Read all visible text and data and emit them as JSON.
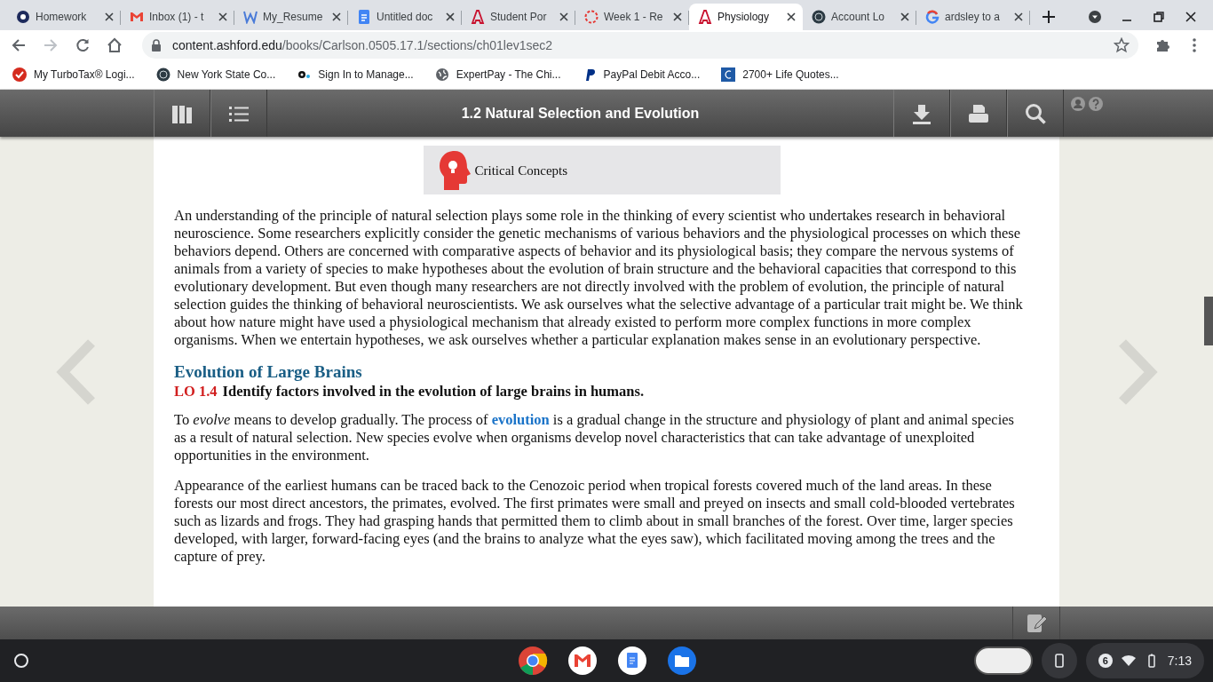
{
  "browser": {
    "tabs": [
      {
        "title": "Homework",
        "selected": false
      },
      {
        "title": "Inbox (1) - t",
        "selected": false
      },
      {
        "title": "My_Resume",
        "selected": false
      },
      {
        "title": "Untitled doc",
        "selected": false
      },
      {
        "title": "Student Por",
        "selected": false
      },
      {
        "title": "Week 1 - Re",
        "selected": false
      },
      {
        "title": "Physiology",
        "selected": true
      },
      {
        "title": "Account Lo",
        "selected": false
      },
      {
        "title": "ardsley to a",
        "selected": false
      }
    ],
    "address": {
      "host": "content.ashford.edu",
      "path": "/books/Carlson.0505.17.1/sections/ch01lev1sec2"
    },
    "bookmarks": [
      {
        "title": "My TurboTax® Logi..."
      },
      {
        "title": "New York State Co..."
      },
      {
        "title": "Sign In to Manage..."
      },
      {
        "title": "ExpertPay - The Chi..."
      },
      {
        "title": "PayPal Debit Acco..."
      },
      {
        "title": "2700+ Life Quotes..."
      }
    ]
  },
  "reader": {
    "title": "1.2 Natural Selection and Evolution",
    "concept_box": {
      "label": "Critical Concepts"
    },
    "blocks": [
      {
        "kind": "paragraph",
        "parts": [
          {
            "kind": "text",
            "text": "An understanding of the principle of natural selection plays some role in the thinking of every scientist who undertakes research in behavioral neuroscience. Some researchers explicitly consider the genetic mechanisms of various behaviors and the physiological processes on which these behaviors depend. Others are concerned with comparative aspects of behavior and its physiological basis; they compare the nervous systems of animals from a variety of species to make hypotheses about the evolution of brain structure and the behavioral capacities that correspond to this evolutionary development. But even though many researchers are not directly involved with the problem of evolution, the principle of natural selection guides the thinking of behavioral neuroscientists. We ask ourselves what the selective advantage of a particular trait might be. We think about how nature might have used a physiological mechanism that already existed to perform more complex functions in more complex organisms. When we entertain hypotheses, we ask ourselves whether a particular explanation makes sense in an evolutionary perspective."
          }
        ]
      },
      {
        "kind": "heading",
        "text": "Evolution of Large Brains"
      },
      {
        "kind": "objective",
        "code": "LO 1.4",
        "text": "Identify factors involved in the evolution of large brains in humans."
      },
      {
        "kind": "paragraph",
        "parts": [
          {
            "kind": "text",
            "text": "To *evolve* means to develop gradually. The process of "
          },
          {
            "kind": "link",
            "text": "evolution"
          },
          {
            "kind": "text",
            "text": " is a gradual change in the structure and physiology of plant and animal species as a result of natural selection. New species evolve when organisms develop novel characteristics that can take advantage of unexploited opportunities in the environment."
          }
        ]
      },
      {
        "kind": "paragraph",
        "parts": [
          {
            "kind": "text",
            "text": "Appearance of the earliest humans can be traced back to the Cenozoic period when tropical forests covered much of the land areas. In these forests our most direct ancestors, the primates, evolved. The first primates were small and preyed on insects and small cold-blooded vertebrates such as lizards and frogs. They had grasping hands that permitted them to climb about in small branches of the forest. Over time, larger species developed, with larger, forward-facing eyes (and the brains to analyze what the eyes saw), which facilitated moving among the trees and the capture of prey."
          }
        ]
      }
    ]
  },
  "shelf": {
    "notification_count": "6",
    "time": "7:13"
  }
}
